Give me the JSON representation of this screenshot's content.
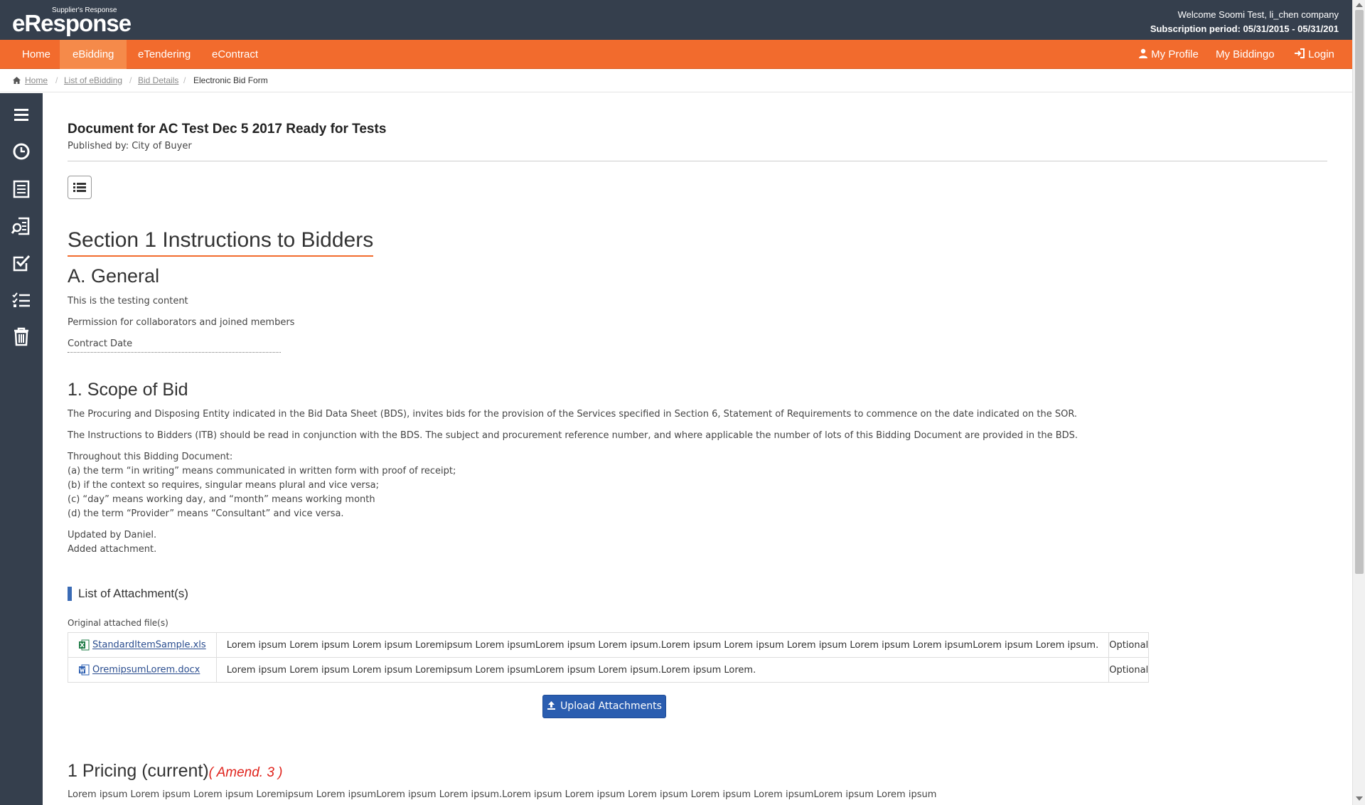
{
  "header": {
    "logo_small": "Supplier's Response",
    "logo_main": "eResponse",
    "welcome": "Welcome Soomi Test, li_chen company",
    "subscription": "Subscription period: 05/31/2015 - 05/31/201"
  },
  "nav": {
    "items": [
      "Home",
      "eBidding",
      "eTendering",
      "eContract"
    ],
    "active": "eBidding",
    "right": [
      "My Profile",
      "My Biddingo",
      "Login"
    ]
  },
  "breadcrumb": {
    "items": [
      "Home",
      "List of eBidding",
      "Bid Details"
    ],
    "current": "Electronic Bid Form",
    "separator": "/"
  },
  "sidebar": {
    "icons": [
      "menu-icon",
      "clock-icon",
      "list-document-icon",
      "search-document-icon",
      "checkbox-icon",
      "checklist-icon",
      "trash-icon"
    ]
  },
  "document": {
    "title": "Document for AC Test Dec 5 2017 Ready for Tests",
    "published_by": "Published by: City of Buyer",
    "section_title": "Section 1 Instructions to Bidders",
    "general": {
      "heading": "A. General",
      "lines": [
        "This is the testing content",
        "Permission for collaborators and joined members",
        "Contract Date"
      ]
    },
    "scope": {
      "heading": "1. Scope of Bid",
      "p1": "The Procuring and Disposing Entity indicated in the Bid Data Sheet (BDS), invites bids for the provision of the Services specified in Section 6, Statement of Requirements to commence on the date indicated on the SOR.",
      "p2": "The Instructions to Bidders (ITB) should be read in conjunction with the BDS. The subject and procurement reference number, and where applicable the number of lots of this Bidding Document are provided in the BDS.",
      "list": [
        "Throughout this Bidding Document:",
        "(a) the term “in writing” means communicated in written form with proof of receipt;",
        "(b) if the context so requires, singular means plural and vice versa;",
        "(c) “day” means working day, and “month” means working month",
        "(d) the term “Provider” means “Consultant” and vice versa."
      ],
      "updates": [
        "Updated by Daniel.",
        "Added attachment."
      ]
    },
    "attachments": {
      "heading": "List of Attachment(s)",
      "subheading": "Original attached file(s)",
      "rows": [
        {
          "file": "StandardItemSample.xls",
          "type": "excel",
          "description": "Lorem ipsum Lorem ipsum Lorem ipsum Loremipsum Lorem ipsumLorem ipsum Lorem ipsum.Lorem ipsum Lorem ipsum Lorem ipsum Lorem ipsum Lorem ipsumLorem ipsum Lorem ipsum.",
          "status": "Optional"
        },
        {
          "file": "OremipsumLorem.docx",
          "type": "word",
          "description": "Lorem ipsum Lorem ipsum Lorem ipsum Loremipsum Lorem ipsumLorem ipsum Lorem ipsum.Lorem ipsum Lorem.",
          "status": "Optional"
        }
      ],
      "upload_label": "Upload Attachments"
    },
    "pricing": {
      "heading": "1 Pricing (current)",
      "amend": "( Amend. 3 )",
      "text": "Lorem ipsum Lorem ipsum Lorem ipsum Loremipsum Lorem ipsumLorem ipsum Lorem ipsum.Lorem ipsum Lorem ipsum Lorem ipsum Lorem ipsum Lorem ipsumLorem ipsum Lorem ipsum"
    }
  },
  "colors": {
    "header_bg": "#353f4d",
    "nav_bg": "#f26b2d",
    "accent": "#f26b2d",
    "button": "#2a5db0",
    "amend": "#e0231c"
  }
}
